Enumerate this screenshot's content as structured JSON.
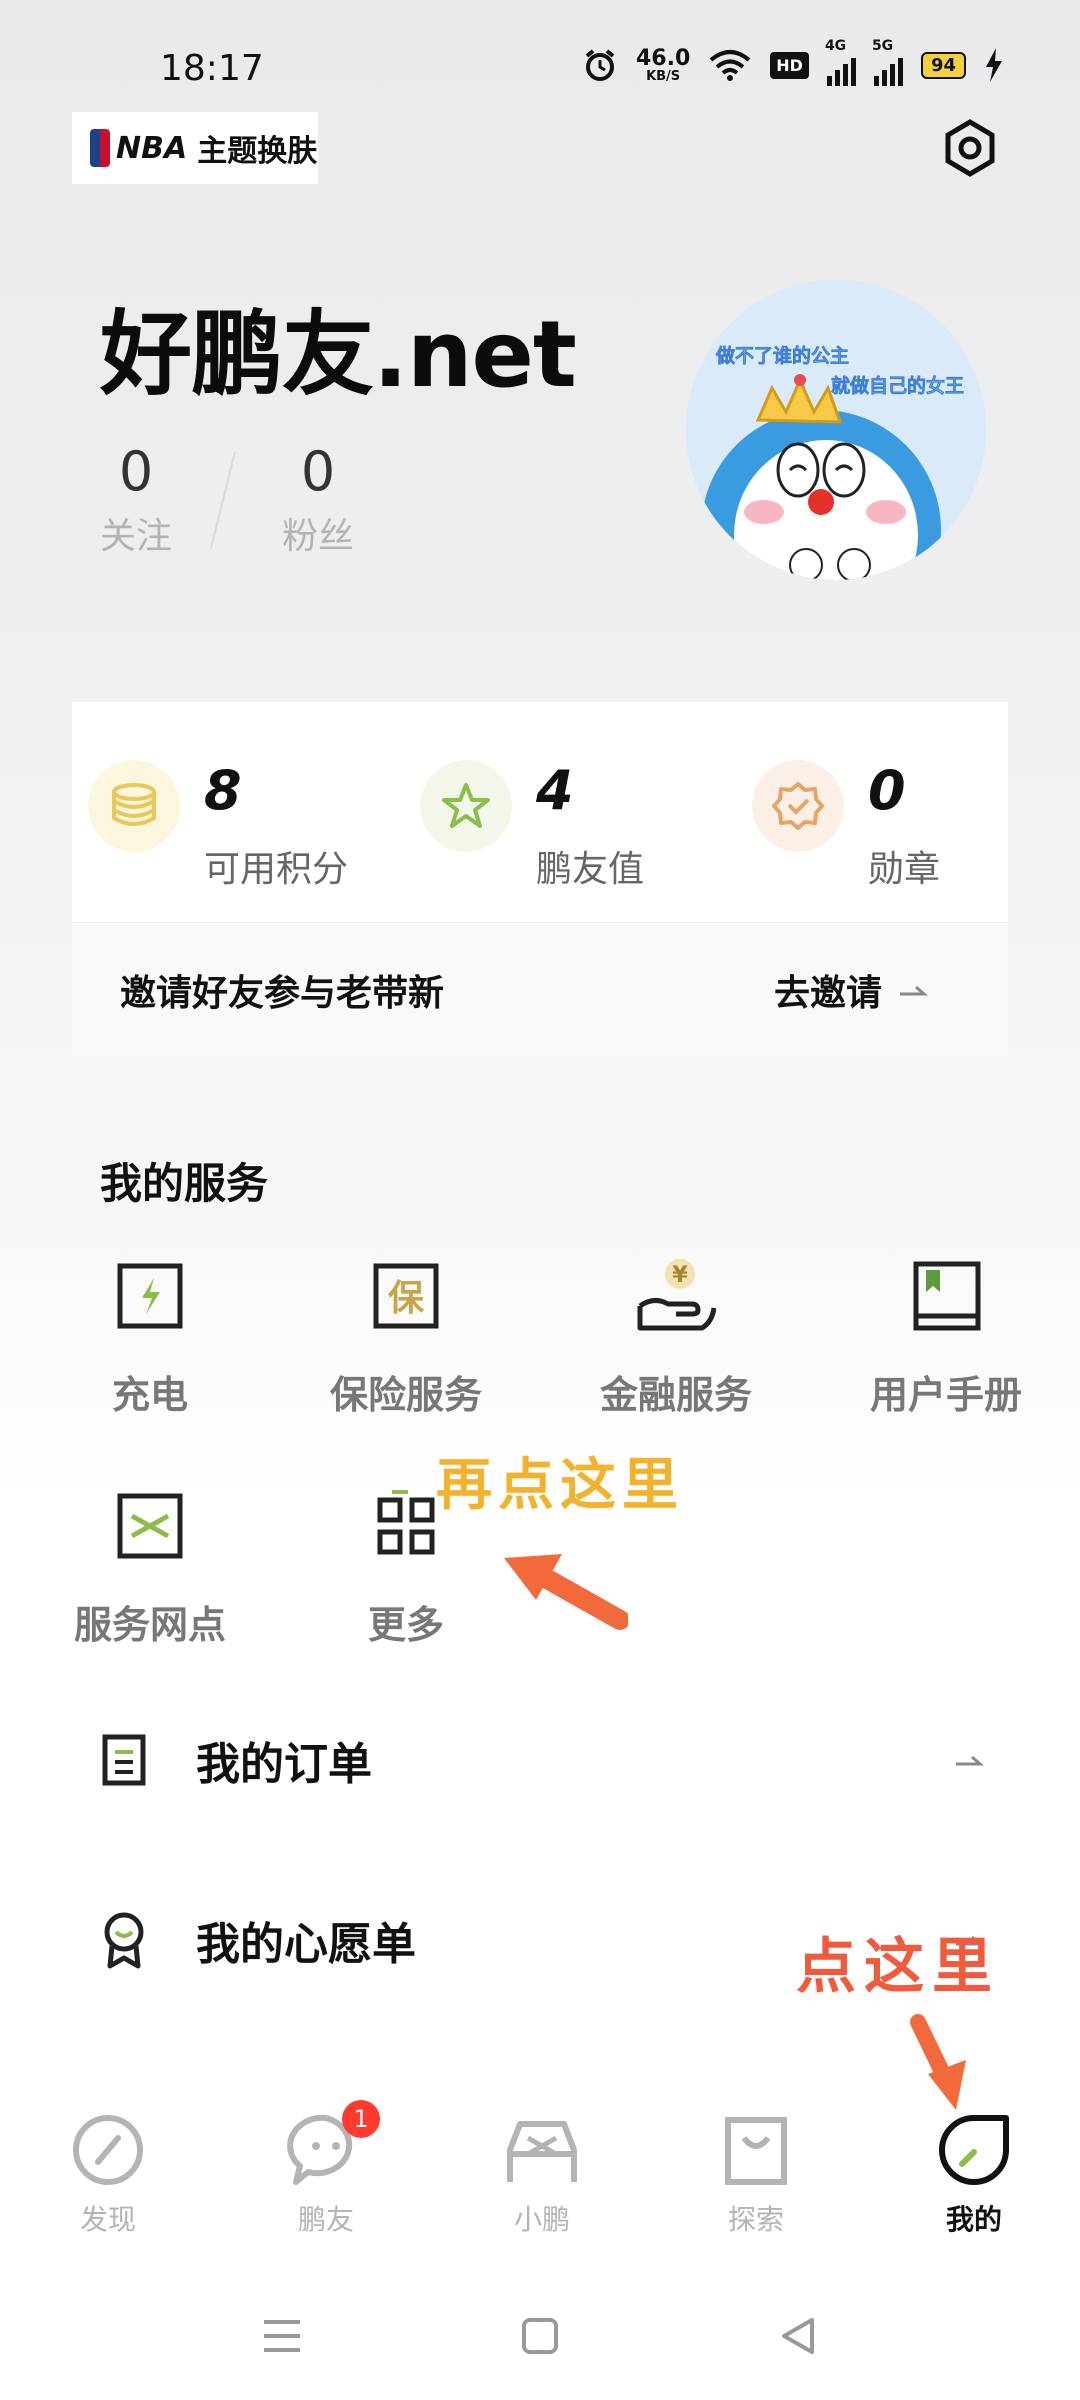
{
  "status_bar": {
    "time": "18:17",
    "net_speed": "46.0",
    "net_unit": "KB/S",
    "hd": "HD",
    "signal1": "4G",
    "signal2": "5G",
    "battery": "94",
    "icons": [
      "alarm-icon",
      "wifi-icon",
      "charging-icon"
    ]
  },
  "header": {
    "theme_chip": "主题换肤",
    "theme_logo": "NBA"
  },
  "profile": {
    "username": "好鹏友.net",
    "following_count": "0",
    "following_label": "关注",
    "followers_count": "0",
    "followers_label": "粉丝",
    "avatar_caption_1": "做不了谁的公主",
    "avatar_caption_2": "就做自己的女王"
  },
  "metrics": [
    {
      "value": "8",
      "label": "可用积分",
      "icon": "coins-icon",
      "color": "#e9c75a"
    },
    {
      "value": "4",
      "label": "鹏友值",
      "icon": "star-icon",
      "color": "#8bbd49"
    },
    {
      "value": "0",
      "label": "勋章",
      "icon": "medal-icon",
      "color": "#e7a36a"
    }
  ],
  "invite": {
    "text": "邀请好友参与老带新",
    "action": "去邀请"
  },
  "services": {
    "title": "我的服务",
    "items": [
      {
        "label": "充电",
        "icon": "charging-icon"
      },
      {
        "label": "保险服务",
        "icon": "insurance-icon",
        "glyph": "保"
      },
      {
        "label": "金融服务",
        "icon": "finance-icon",
        "glyph": "¥"
      },
      {
        "label": "用户手册",
        "icon": "manual-icon"
      },
      {
        "label": "服务网点",
        "icon": "service-point-icon"
      },
      {
        "label": "更多",
        "icon": "grid-icon"
      }
    ]
  },
  "annotations": {
    "more_hint": "再点这里",
    "me_hint": "点这里"
  },
  "list": {
    "orders": "我的订单",
    "wishlist": "我的心愿单"
  },
  "tabbar": {
    "items": [
      {
        "label": "发现",
        "icon": "discover-icon"
      },
      {
        "label": "鹏友",
        "icon": "chat-icon",
        "badge": "1"
      },
      {
        "label": "小鹏",
        "icon": "car-icon"
      },
      {
        "label": "探索",
        "icon": "shopping-bag-icon"
      },
      {
        "label": "我的",
        "icon": "me-icon",
        "active": true
      }
    ]
  },
  "colors": {
    "accent_green": "#8bbd49",
    "annotation_orange": "#f3b22c",
    "annotation_red": "#f05b3d",
    "badge_red": "#ff3b30"
  }
}
